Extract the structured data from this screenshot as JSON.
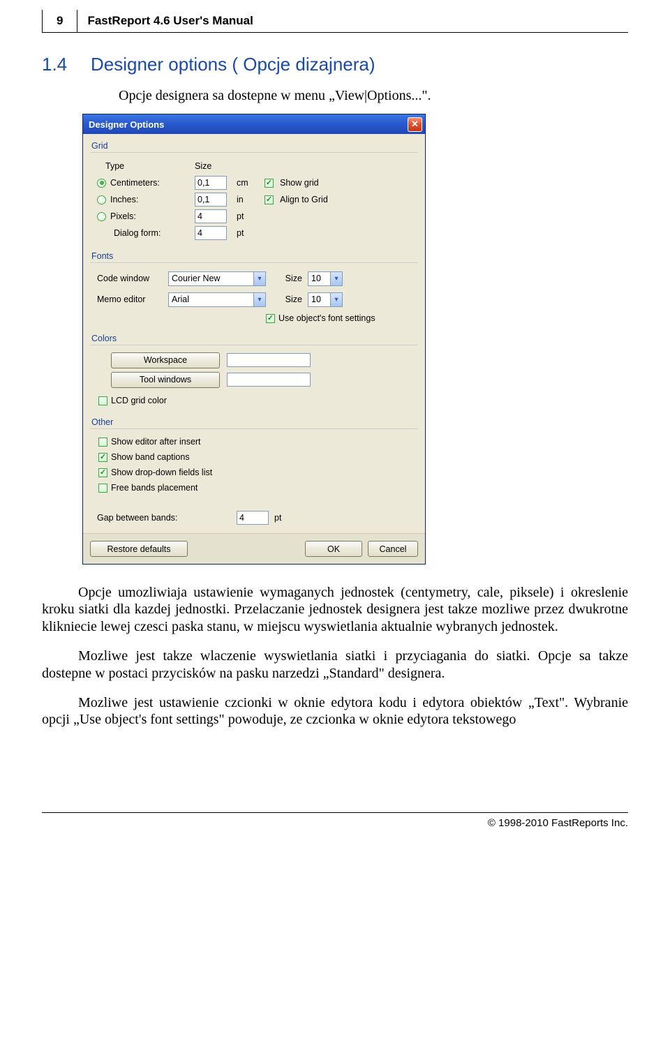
{
  "page_number": "9",
  "manual_title": "FastReport 4.6 User's Manual",
  "section_number": "1.4",
  "section_title": "Designer options ( Opcje dizajnera)",
  "intro": "Opcje designera sa dostepne w menu „View|Options...\".",
  "dialog": {
    "title": "Designer Options",
    "groups": {
      "grid": {
        "label": "Grid",
        "type_label": "Type",
        "size_label": "Size",
        "centimeters": "Centimeters:",
        "inches": "Inches:",
        "pixels": "Pixels:",
        "dialog_form": "Dialog form:",
        "cm_val": "0,1",
        "cm_unit": "cm",
        "in_val": "0,1",
        "in_unit": "in",
        "pt_val": "4",
        "pt_unit": "pt",
        "df_val": "4",
        "df_unit": "pt",
        "show_grid": "Show grid",
        "align_grid": "Align to Grid"
      },
      "fonts": {
        "label": "Fonts",
        "code_window": "Code window",
        "memo_editor": "Memo editor",
        "code_font": "Courier New",
        "memo_font": "Arial",
        "size_label": "Size",
        "code_size": "10",
        "memo_size": "10",
        "use_object": "Use object's font settings"
      },
      "colors": {
        "label": "Colors",
        "workspace": "Workspace",
        "tool_windows": "Tool windows",
        "lcd": "LCD grid color"
      },
      "other": {
        "label": "Other",
        "show_editor": "Show editor after insert",
        "show_band": "Show band captions",
        "show_dd": "Show drop-down fields list",
        "free_bands": "Free bands placement",
        "gap_label": "Gap between bands:",
        "gap_val": "4",
        "gap_unit": "pt"
      }
    },
    "buttons": {
      "restore": "Restore defaults",
      "ok": "OK",
      "cancel": "Cancel"
    }
  },
  "paragraphs": {
    "p1": "Opcje umozliwiaja ustawienie wymaganych jednostek (centymetry, cale, piksele) i okreslenie kroku siatki dla kazdej jednostki. Przelaczanie jednostek designera jest takze mozliwe przez dwukrotne klikniecie lewej czesci paska stanu, w miejscu wyswietlania aktualnie wybranych jednostek.",
    "p2": "Mozliwe jest takze wlaczenie wyswietlania siatki i przyciagania do siatki. Opcje sa takze dostepne w postaci przycisków na pasku narzedzi „Standard\" designera.",
    "p3": "Mozliwe jest ustawienie czcionki w oknie edytora kodu i edytora obiektów „Text\". Wybranie opcji „Use object's font settings\" powoduje, ze czcionka w oknie edytora tekstowego"
  },
  "footer": "© 1998-2010 FastReports Inc."
}
